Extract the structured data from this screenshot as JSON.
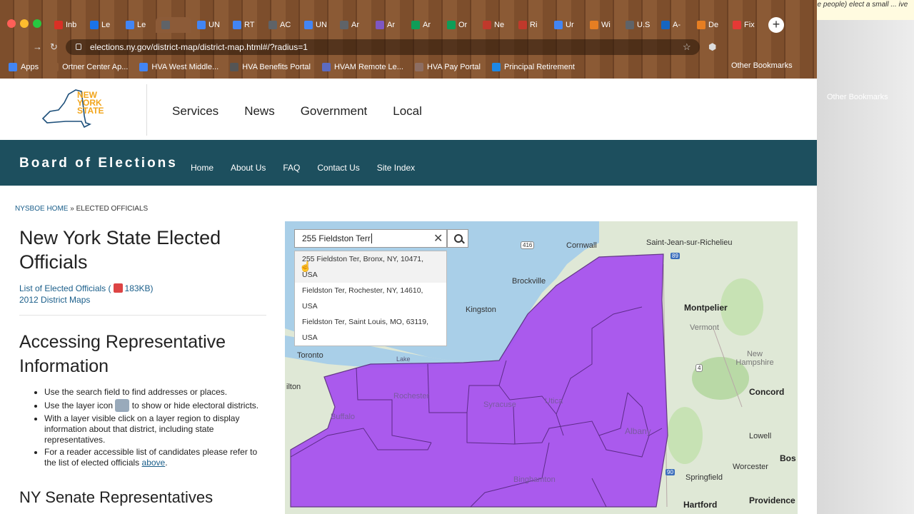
{
  "desktop": {
    "note_text": "In a representative democracy, we (the people) elect a small ... ive power to make laws for",
    "other_bookmarks": "Other Bookmarks"
  },
  "browser": {
    "tabs": [
      {
        "label": "Inb",
        "color": "#d93025"
      },
      {
        "label": "Le",
        "color": "#1a73e8"
      },
      {
        "label": "Le",
        "color": "#4285f4"
      },
      {
        "label": "",
        "color": "#5f6368",
        "active": true
      },
      {
        "label": "UN",
        "color": "#4285f4"
      },
      {
        "label": "RT",
        "color": "#4285f4"
      },
      {
        "label": "AC",
        "color": "#5f6368"
      },
      {
        "label": "UN",
        "color": "#4285f4"
      },
      {
        "label": "Ar",
        "color": "#5f6368"
      },
      {
        "label": "Ar",
        "color": "#7e57c2"
      },
      {
        "label": "Ar",
        "color": "#0f9d58"
      },
      {
        "label": "Or",
        "color": "#0f9d58"
      },
      {
        "label": "Ne",
        "color": "#c0392b"
      },
      {
        "label": "Ri",
        "color": "#c0392b"
      },
      {
        "label": "Ur",
        "color": "#4285f4"
      },
      {
        "label": "Wi",
        "color": "#e67e22"
      },
      {
        "label": "U.S",
        "color": "#5f6368"
      },
      {
        "label": "A-",
        "color": "#1565c0"
      },
      {
        "label": "De",
        "color": "#e67e22"
      },
      {
        "label": "Fix",
        "color": "#e53935"
      }
    ],
    "url": "elections.ny.gov/district-map/district-map.html#/?radius=1",
    "bookmarks": [
      {
        "label": "Apps",
        "color": "#4285f4"
      },
      {
        "label": "Ortner Center Ap...",
        "color": "#8b5a35"
      },
      {
        "label": "HVA West Middle...",
        "color": "#4285f4"
      },
      {
        "label": "HVA Benefits Portal",
        "color": "#555"
      },
      {
        "label": "HVAM Remote Le...",
        "color": "#5c6bc0"
      },
      {
        "label": "HVA Pay Portal",
        "color": "#8d6e63"
      },
      {
        "label": "Principal Retirement",
        "color": "#1e88e5"
      }
    ],
    "other_bookmarks": "Other Bookmarks"
  },
  "site": {
    "logo": {
      "line1": "NEW",
      "line2": "YORK",
      "line3": "STATE"
    },
    "gov_nav": [
      "Services",
      "News",
      "Government",
      "Local"
    ],
    "boe_title": "Board of Elections",
    "boe_nav": [
      "Home",
      "About Us",
      "FAQ",
      "Contact Us",
      "Site Index"
    ],
    "breadcrumb": {
      "home": "NYSBOE HOME",
      "sep": "»",
      "current": "ELECTED OFFICIALS"
    },
    "title": "New York State Elected Officials",
    "list_link": "List of Elected Officials",
    "list_size": "183KB",
    "maps_link": "2012 District Maps",
    "section_title": "Accessing Representative Information",
    "bullets": {
      "b1": "Use the search field to find addresses or places.",
      "b2a": "Use the layer icon",
      "b2b": "to show or hide electoral districts.",
      "b3": "With a layer visible click on a layer region to display information about that district, including state representatives.",
      "b4a": "For a reader accessible list of candidates please refer to the list of elected officials",
      "b4link": "above",
      "b4b": "."
    },
    "senate_title": "NY Senate Representatives"
  },
  "map": {
    "search_value": "255 Fieldston Terr",
    "suggestions": [
      {
        "line1": "255 Fieldston Ter, Bronx, NY, 10471,",
        "line2": "USA"
      },
      {
        "line1": "Fieldston Ter, Rochester, NY, 14610,",
        "line2": "USA"
      },
      {
        "line1": "Fieldston Ter, Saint Louis, MO, 63119,",
        "line2": "USA"
      }
    ],
    "labels": {
      "saint_jean": "Saint-Jean-sur-Richelieu",
      "cornwall": "Cornwall",
      "brockville": "Brockville",
      "kingston": "Kingston",
      "toronto": "Toronto",
      "hamilton": "ilton",
      "lake": "Lake",
      "montpelier": "Montpelier",
      "vermont": "Vermont",
      "new_hampshire": "New Hampshire",
      "concord": "Concord",
      "lowell": "Lowell",
      "boston": "Bos",
      "worcester": "Worcester",
      "springfield": "Springfield",
      "providence": "Providence",
      "hartford": "Hartford",
      "rochester": "Rochester",
      "syracuse": "Syracuse",
      "utica": "Utica",
      "albany": "Albany",
      "binghamton": "Binghamton",
      "buffalo": "Buffalo",
      "r416": "416",
      "r4": "4",
      "r90": "90",
      "r89": "89"
    },
    "district_color": "#a64ef0"
  }
}
